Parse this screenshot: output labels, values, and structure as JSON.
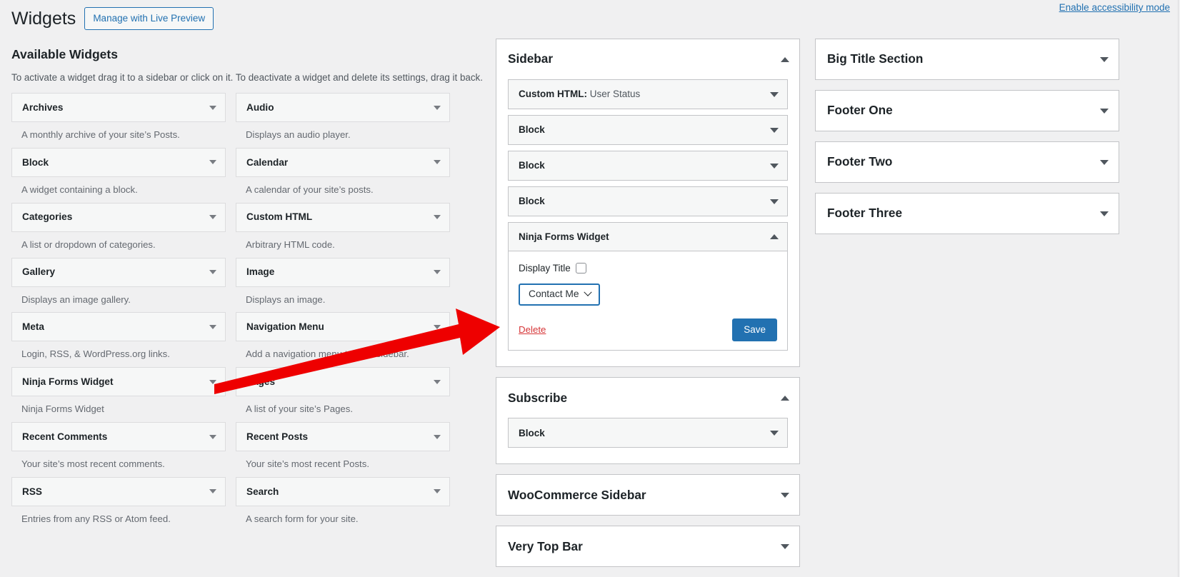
{
  "header": {
    "page_title": "Widgets",
    "live_preview_label": "Manage with Live Preview",
    "accessibility_link": "Enable accessibility mode"
  },
  "available": {
    "heading": "Available Widgets",
    "description": "To activate a widget drag it to a sidebar or click on it. To deactivate a widget and delete its settings, drag it back.",
    "column_left": [
      {
        "title": "Archives",
        "desc": "A monthly archive of your site’s Posts."
      },
      {
        "title": "Block",
        "desc": "A widget containing a block."
      },
      {
        "title": "Categories",
        "desc": "A list or dropdown of categories."
      },
      {
        "title": "Gallery",
        "desc": "Displays an image gallery."
      },
      {
        "title": "Meta",
        "desc": "Login, RSS, & WordPress.org links."
      },
      {
        "title": "Ninja Forms Widget",
        "desc": "Ninja Forms Widget"
      },
      {
        "title": "Recent Comments",
        "desc": "Your site’s most recent comments."
      },
      {
        "title": "RSS",
        "desc": "Entries from any RSS or Atom feed."
      }
    ],
    "column_right": [
      {
        "title": "Audio",
        "desc": "Displays an audio player."
      },
      {
        "title": "Calendar",
        "desc": "A calendar of your site’s posts."
      },
      {
        "title": "Custom HTML",
        "desc": "Arbitrary HTML code."
      },
      {
        "title": "Image",
        "desc": "Displays an image."
      },
      {
        "title": "Navigation Menu",
        "desc": "Add a navigation menu to your sidebar."
      },
      {
        "title": "Pages",
        "desc": "A list of your site’s Pages."
      },
      {
        "title": "Recent Posts",
        "desc": "Your site’s most recent Posts."
      },
      {
        "title": "Search",
        "desc": "A search form for your site."
      }
    ]
  },
  "sidebars_middle": [
    {
      "name": "Sidebar",
      "expanded": true,
      "widgets": [
        {
          "label_bold": "Custom HTML:",
          "label_sub": " User Status",
          "open": false
        },
        {
          "label_bold": "Block",
          "label_sub": "",
          "open": false
        },
        {
          "label_bold": "Block",
          "label_sub": "",
          "open": false
        },
        {
          "label_bold": "Block",
          "label_sub": "",
          "open": false
        },
        {
          "label_bold": "Ninja Forms Widget",
          "label_sub": "",
          "open": true
        }
      ]
    },
    {
      "name": "Subscribe",
      "expanded": true,
      "widgets": [
        {
          "label_bold": "Block",
          "label_sub": "",
          "open": false
        }
      ]
    },
    {
      "name": "WooCommerce Sidebar",
      "expanded": false,
      "widgets": []
    },
    {
      "name": "Very Top Bar",
      "expanded": false,
      "widgets": []
    }
  ],
  "sidebars_right": [
    {
      "name": "Big Title Section",
      "expanded": false
    },
    {
      "name": "Footer One",
      "expanded": false
    },
    {
      "name": "Footer Two",
      "expanded": false
    },
    {
      "name": "Footer Three",
      "expanded": false
    }
  ],
  "ninja_form": {
    "display_title_label": "Display Title",
    "display_title_checked": false,
    "selected_form": "Contact Me",
    "delete_label": "Delete",
    "save_label": "Save"
  },
  "colors": {
    "accent_blue": "#2271b1",
    "delete_red": "#d63638",
    "annotation_red": "#ee0000",
    "panel_bg": "#ffffff",
    "page_bg": "#f0f0f1",
    "widget_bg": "#f6f7f7",
    "border": "#c3c4c7"
  }
}
